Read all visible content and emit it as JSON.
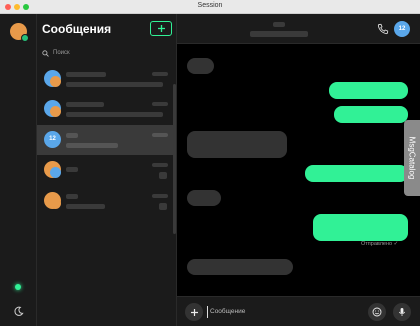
{
  "window": {
    "title": "Session"
  },
  "sidebar": {
    "title": "Сообщения",
    "search_placeholder": "Поиск"
  },
  "conversations": [
    {
      "avatar_color": "#5aa7ea",
      "badge_color": "#e89a4a",
      "active": false
    },
    {
      "avatar_color": "#5aa7ea",
      "badge_color": "#e89a4a",
      "active": false
    },
    {
      "avatar_color": "#5aa7ea",
      "initials": "12",
      "active": true
    },
    {
      "avatar_color": "#e89a4a",
      "badge_color": "#5aa7ea",
      "active": false
    },
    {
      "avatar_color": "#e89a4a",
      "badge_color": "#e89a4a",
      "active": false
    }
  ],
  "chat": {
    "header_initials": "12",
    "status_text": "Отправлено",
    "side_tab": "MsgCatalog"
  },
  "composer": {
    "placeholder": "Сообщение"
  },
  "colors": {
    "accent": "#31f196",
    "bubble_in": "#333333",
    "background": "#000000"
  },
  "icons": {
    "new_chat": "plus-icon",
    "search": "search-icon",
    "call": "phone-icon",
    "attach": "plus-icon",
    "emoji": "emoji-icon",
    "voice": "microphone-icon",
    "theme": "moon-icon",
    "sent": "checkmark-icon"
  }
}
